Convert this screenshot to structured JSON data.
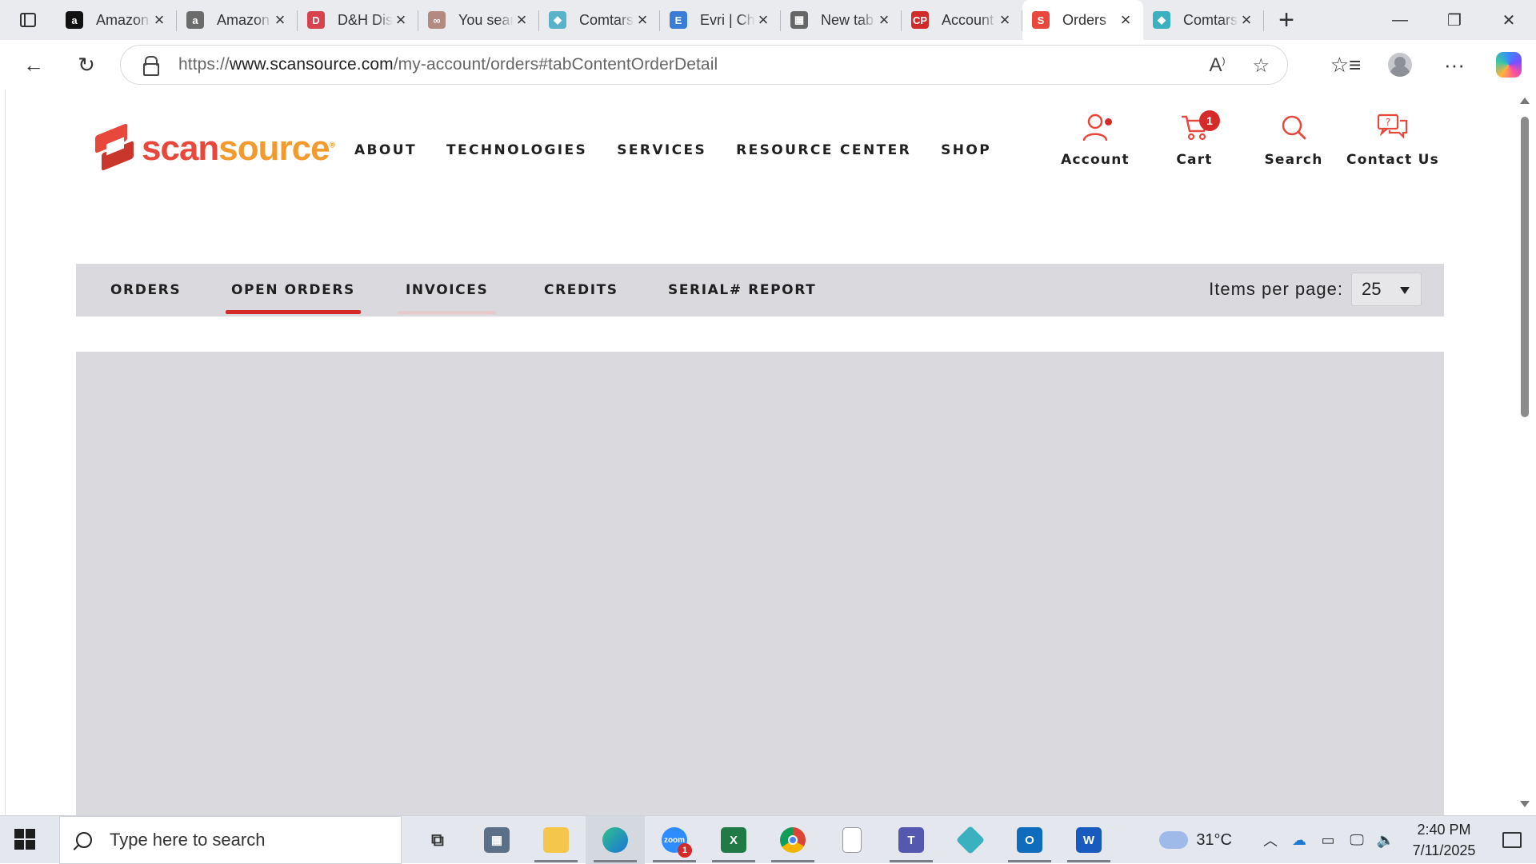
{
  "browser": {
    "tabs": [
      {
        "title": "Amazon",
        "favicon": "amazon-icon",
        "color": "#111111",
        "glyph": "a"
      },
      {
        "title": "Amazon",
        "favicon": "amazon-icon",
        "color": "#6b6b6b",
        "glyph": "a"
      },
      {
        "title": "D&H Distributing",
        "favicon": "dh-icon",
        "color": "#d8424c",
        "glyph": "D"
      },
      {
        "title": "You searched",
        "favicon": "circles-icon",
        "color": "#b18a82",
        "glyph": "∞"
      },
      {
        "title": "Comtarsia",
        "favicon": "comtarsia-icon",
        "color": "#58b3c9",
        "glyph": "◆"
      },
      {
        "title": "Evri | Check",
        "favicon": "evri-icon",
        "color": "#3a7dd8",
        "glyph": "E"
      },
      {
        "title": "New tab",
        "favicon": "newtab-icon",
        "color": "#666666",
        "glyph": "▦"
      },
      {
        "title": "Account",
        "favicon": "cp-icon",
        "color": "#d12a2a",
        "glyph": "CP"
      },
      {
        "title": "Orders",
        "favicon": "scansource-icon",
        "color": "#e8483b",
        "glyph": "S"
      },
      {
        "title": "Comtarsia",
        "favicon": "comtarsia-icon",
        "color": "#3bb0be",
        "glyph": "◆"
      }
    ],
    "active_tab_index": 8,
    "url_prefix": "https://",
    "url_domain": "www.scansource.com",
    "url_path": "/my-account/orders#tabContentOrderDetail"
  },
  "site": {
    "logo_scan": "scan",
    "logo_source": "source",
    "nav": [
      "ABOUT",
      "TECHNOLOGIES",
      "SERVICES",
      "RESOURCE CENTER",
      "SHOP"
    ],
    "util": {
      "account": "Account",
      "cart": "Cart",
      "cart_count": "1",
      "search": "Search",
      "contact": "Contact Us"
    },
    "accent_color": "#d42a2a"
  },
  "account_tabs": {
    "items": [
      "ORDERS",
      "OPEN ORDERS",
      "INVOICES",
      "CREDITS",
      "SERIAL# REPORT"
    ],
    "active": "OPEN ORDERS",
    "items_per_page_label": "Items per page:",
    "items_per_page_value": "25"
  },
  "taskbar": {
    "search_placeholder": "Type here to search",
    "apps": [
      "task-view-icon",
      "calculator-icon",
      "file-explorer-icon",
      "edge-icon",
      "zoom-icon",
      "excel-icon",
      "chrome-icon",
      "notepad-icon",
      "teams-icon",
      "comtarsia-icon",
      "outlook-icon",
      "word-icon"
    ],
    "zoom_badge": "1",
    "temperature": "31°C",
    "time": "2:40 PM",
    "date": "7/11/2025"
  }
}
